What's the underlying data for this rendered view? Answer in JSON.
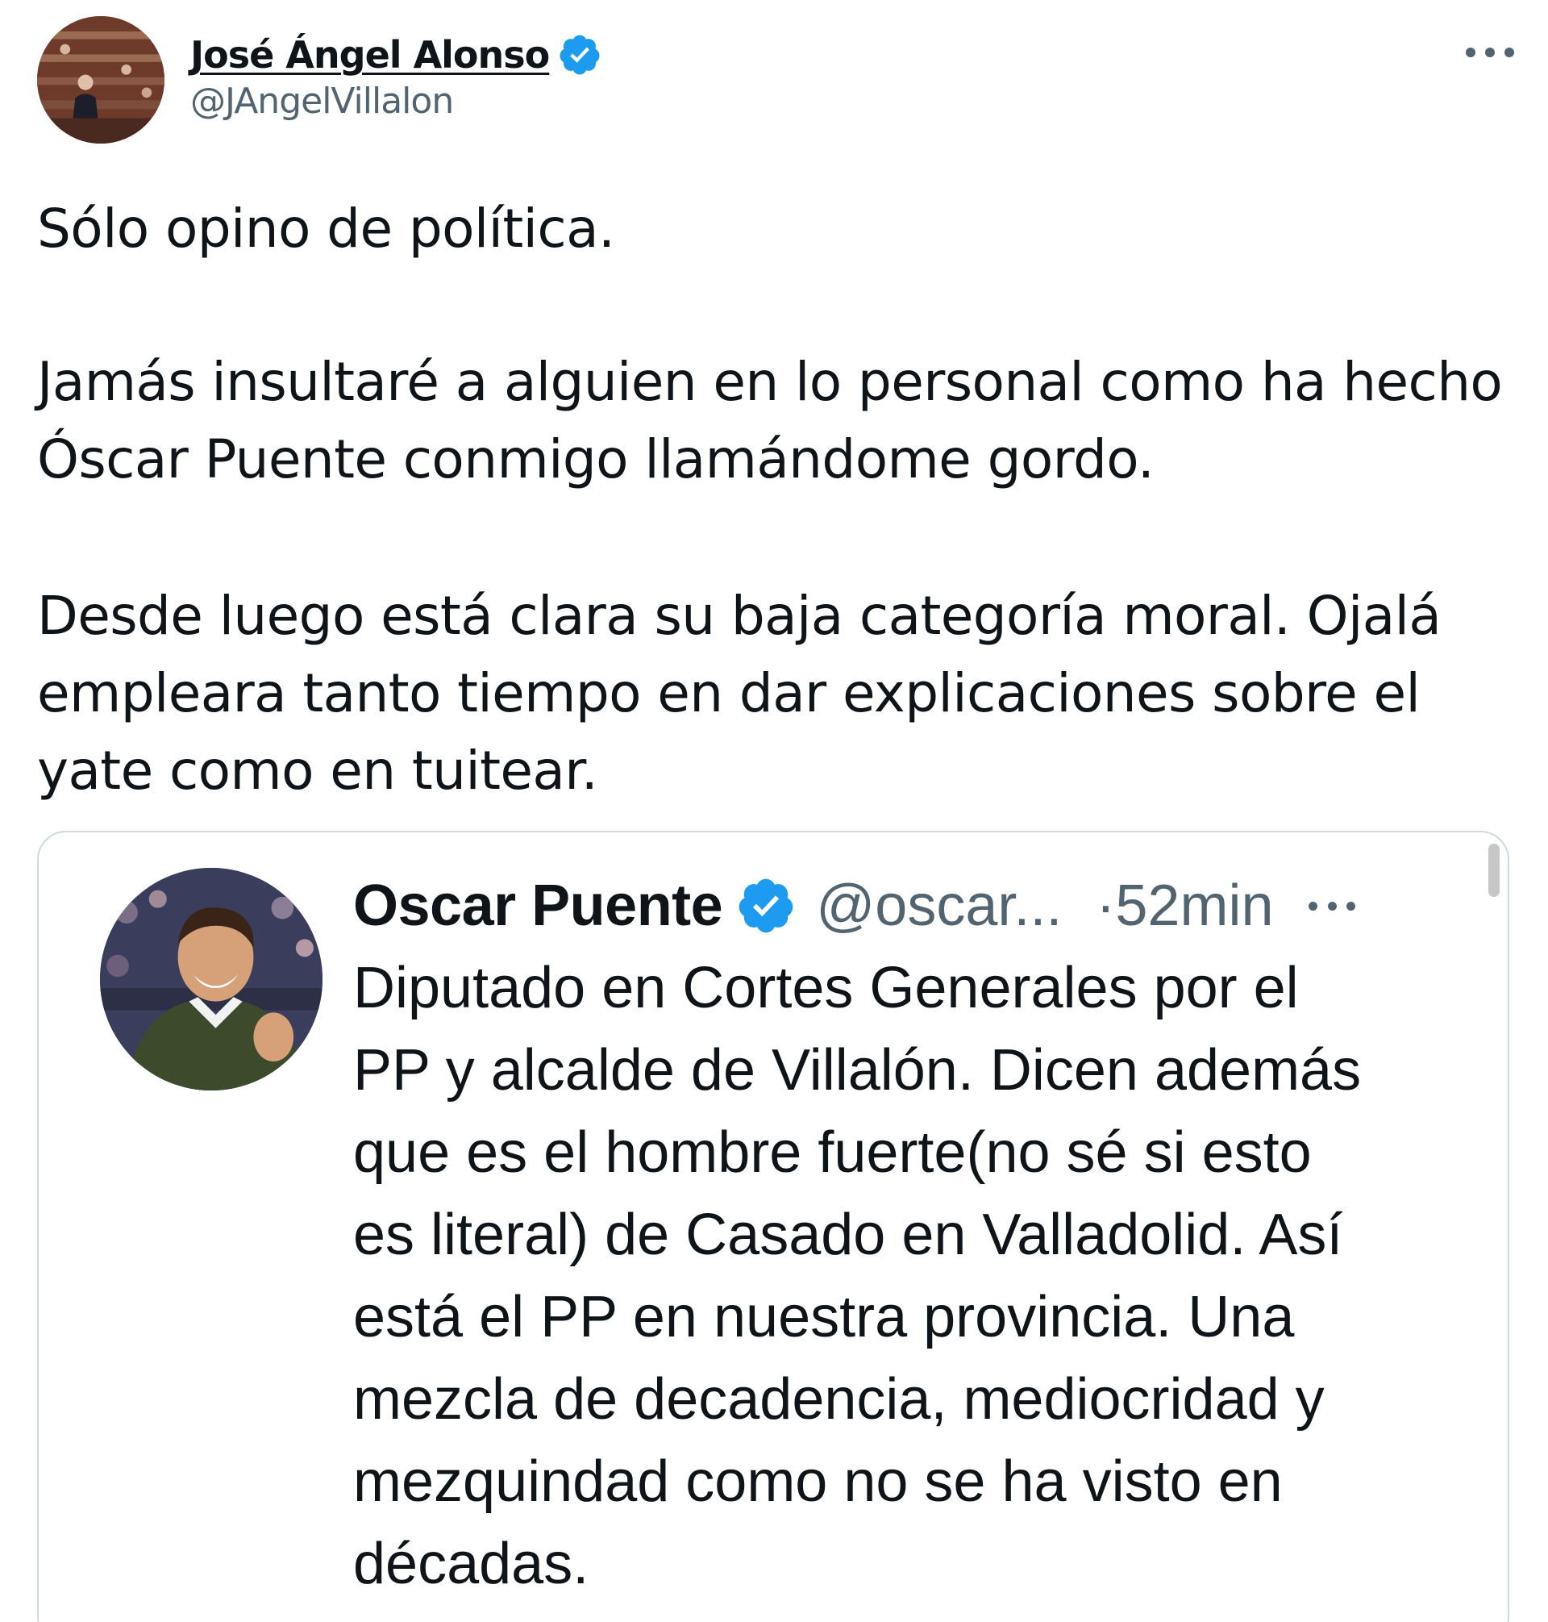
{
  "author": {
    "name": "José Ángel Alonso",
    "handle": "@JAngelVillalon",
    "verified": true,
    "avatar_icon": "profile-photo-parliament"
  },
  "tweet": {
    "paragraphs": [
      [
        "Sólo opino de política."
      ],
      [
        "Jamás insultaré a alguien en lo personal como ha hecho",
        "Óscar Puente conmigo llamándome gordo."
      ],
      [
        "Desde luego está clara su baja categoría moral. Ojalá",
        "empleara tanto tiempo en dar explicaciones sobre el",
        "yate como en tuitear."
      ]
    ]
  },
  "quoted_tweet": {
    "name": "Oscar Puente",
    "handle": "@oscar...",
    "time": "·52min",
    "verified": true,
    "avatar_icon": "profile-photo-smiling-man",
    "lines": [
      "Diputado en Cortes Generales por el",
      "PP y alcalde de Villalón. Dicen además",
      "que es el hombre fuerte(no sé si esto",
      "es literal) de Casado en Valladolid. Así",
      "está el PP en nuestra provincia. Una",
      "mezcla de decadencia, mediocridad y",
      "mezquindad como no se ha visto en",
      "décadas."
    ]
  },
  "colors": {
    "text": "#0f1419",
    "secondary": "#536471",
    "verified_blue": "#1d9bf0",
    "border": "#cfd9de"
  }
}
